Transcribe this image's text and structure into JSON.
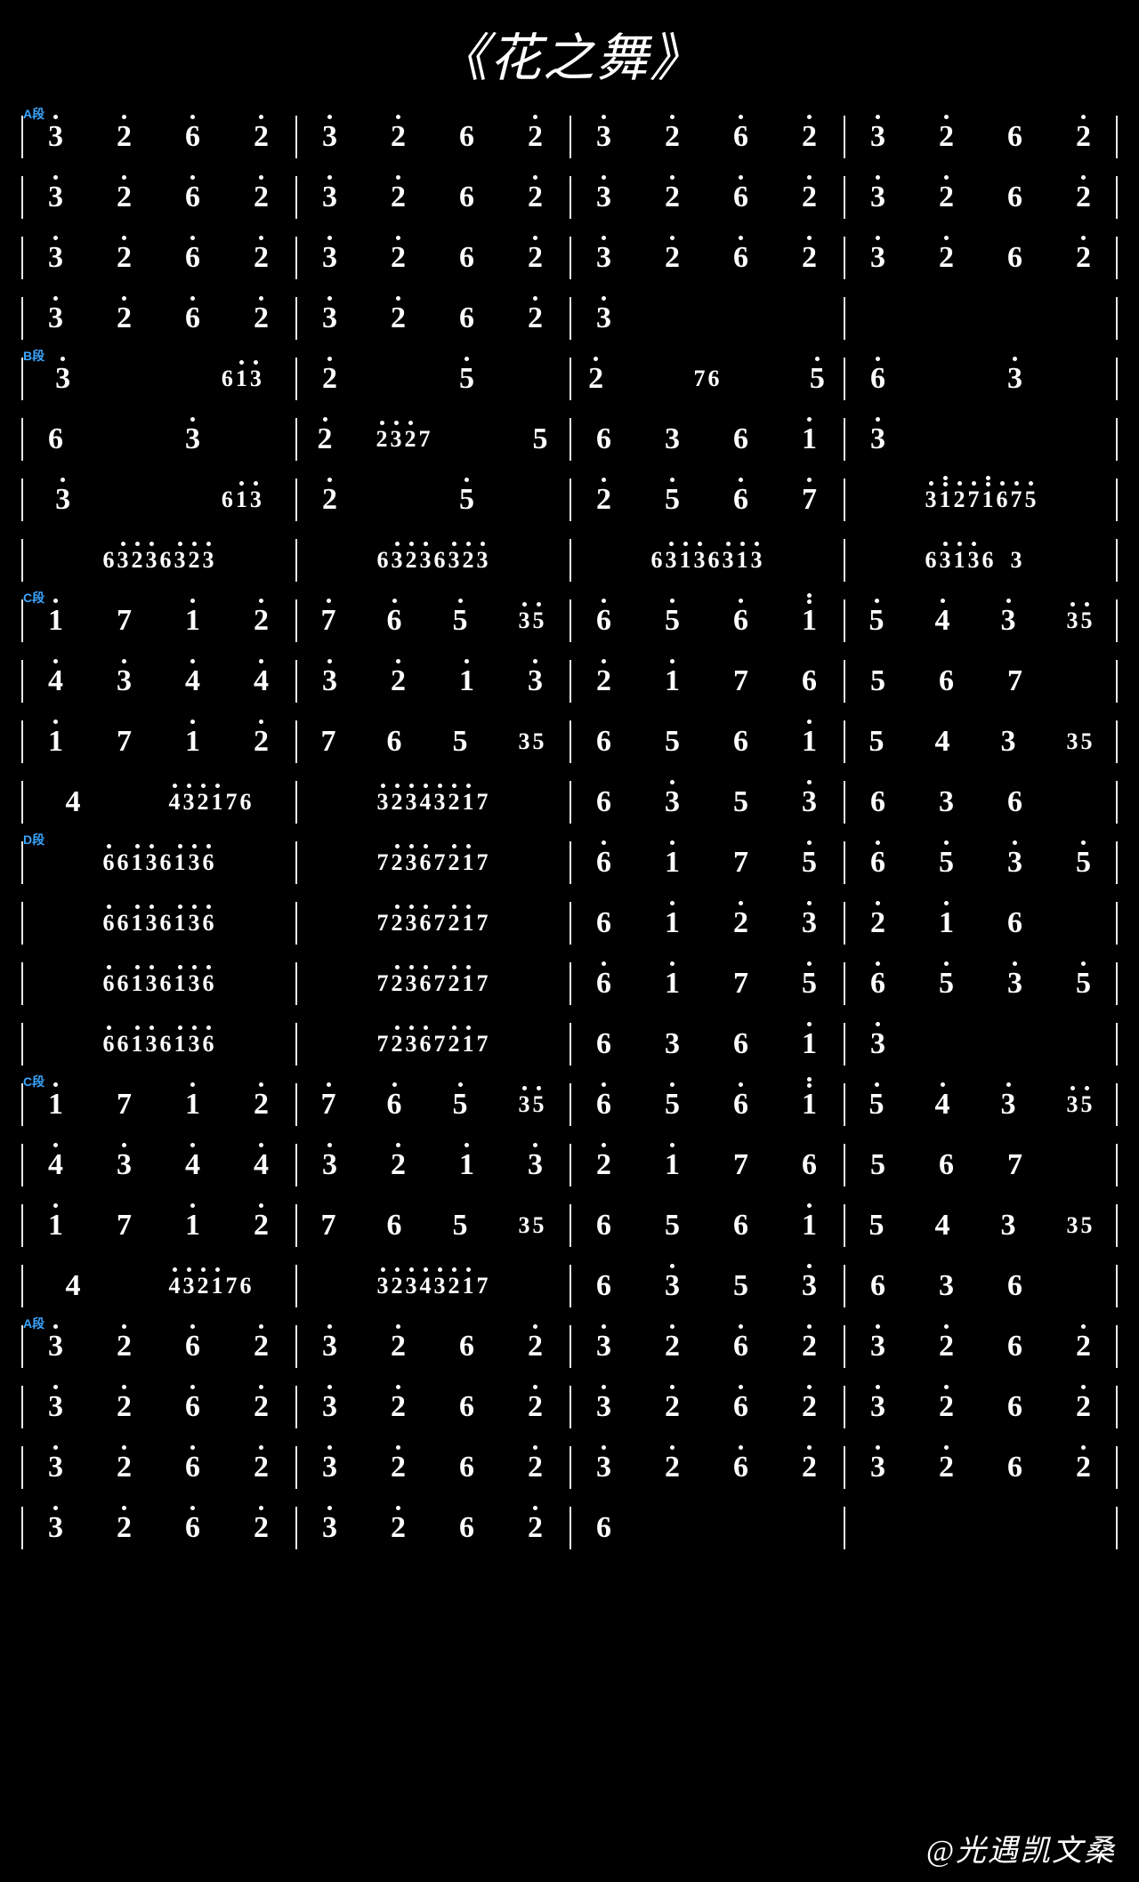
{
  "title": "《花之舞》",
  "credit": "@光遇凯文桑",
  "note_encoding": "Each note token: <digit><suffix>. digit 1-7 or _ (blank). suffix: '.'=dot above (high octave), ':'=two dots above, ','=dot below, ''=middle. Tokens separated by space inside a beat-group; groups separated by | inside a measure.",
  "lines": [
    {
      "section": "A段",
      "measures": [
        [
          "3.",
          "2.",
          "6.",
          "2."
        ],
        [
          "3.",
          "2.",
          "6",
          "2."
        ],
        [
          "3.",
          "2.",
          "6.",
          "2."
        ],
        [
          "3.",
          "2.",
          "6",
          "2."
        ]
      ]
    },
    {
      "measures": [
        [
          "3.",
          "2.",
          "6.",
          "2."
        ],
        [
          "3.",
          "2.",
          "6",
          "2."
        ],
        [
          "3.",
          "2.",
          "6.",
          "2."
        ],
        [
          "3.",
          "2.",
          "6",
          "2."
        ]
      ]
    },
    {
      "measures": [
        [
          "3.",
          "2.",
          "6.",
          "2."
        ],
        [
          "3.",
          "2.",
          "6",
          "2."
        ],
        [
          "3.",
          "2.",
          "6.",
          "2."
        ],
        [
          "3.",
          "2.",
          "6",
          "2."
        ]
      ]
    },
    {
      "measures": [
        [
          "3.",
          "2.",
          "6.",
          "2."
        ],
        [
          "3.",
          "2.",
          "6",
          "2."
        ],
        [
          "3.",
          "_",
          "_",
          "_"
        ],
        [
          "_",
          "_",
          "_",
          "_"
        ]
      ]
    },
    {
      "section": "B段",
      "measures": [
        [
          "3.",
          "_",
          "6 1. 3."
        ],
        [
          "2.",
          "_",
          "5.",
          "_"
        ],
        [
          "2.",
          "_",
          "7 6",
          "_",
          "5."
        ],
        [
          "6.",
          "_",
          "3.",
          "_"
        ]
      ]
    },
    {
      "measures": [
        [
          "6",
          "_",
          "3.",
          "_"
        ],
        [
          "2.",
          "2. 3. 2. 7",
          "_",
          "5"
        ],
        [
          "6",
          "3",
          "6",
          "1."
        ],
        [
          "3.",
          "_",
          "_",
          "_"
        ]
      ]
    },
    {
      "measures": [
        [
          "3.",
          "_",
          "6 1. 3."
        ],
        [
          "2.",
          "_",
          "5.",
          "_"
        ],
        [
          "2.",
          "5.",
          "6.",
          "7."
        ],
        [
          "3. 1: 2. 7. 1: 6. 7. 5."
        ]
      ]
    },
    {
      "measures": [
        [
          "6 3. 2. 3. 6 3. 2. 3."
        ],
        [
          "6 3. 2. 3. 6 3. 2. 3."
        ],
        [
          "6 3. 1. 3. 6 3. 1. 3."
        ],
        [
          "6 3. 1. 3. 6 _ 3 _"
        ]
      ]
    },
    {
      "section": "C段",
      "measures": [
        [
          "1.",
          "7",
          "1.",
          "2."
        ],
        [
          "7.",
          "6.",
          "5.",
          "3. 5."
        ],
        [
          "6.",
          "5.",
          "6.",
          "1:"
        ],
        [
          "5.",
          "4.",
          "3.",
          "3. 5."
        ]
      ]
    },
    {
      "measures": [
        [
          "4.",
          "3.",
          "4.",
          "4."
        ],
        [
          "3.",
          "2.",
          "1.",
          "3."
        ],
        [
          "2.",
          "1.",
          "7",
          "6"
        ],
        [
          "5",
          "6",
          "7",
          "_"
        ]
      ]
    },
    {
      "measures": [
        [
          "1.",
          "7",
          "1.",
          "2."
        ],
        [
          "7",
          "6",
          "5",
          "3 5"
        ],
        [
          "6",
          "5",
          "6",
          "1."
        ],
        [
          "5",
          "4",
          "3",
          "3 5"
        ]
      ]
    },
    {
      "measures": [
        [
          "4",
          "4. 3. 2. 1. 7 6"
        ],
        [
          "3. 2. 3. 4. 3. 2. 1. 7"
        ],
        [
          "6",
          "3.",
          "5",
          "3."
        ],
        [
          "6",
          "3",
          "6",
          "_"
        ]
      ]
    },
    {
      "section": "D段",
      "measures": [
        [
          "6. 6 1. 3. 6 1. 3. 6."
        ],
        [
          "7 2. 3. 6. 7 2. 1. 7"
        ],
        [
          "6.",
          "1.",
          "7",
          "5."
        ],
        [
          "6.",
          "5.",
          "3.",
          "5."
        ]
      ]
    },
    {
      "measures": [
        [
          "6. 6 1. 3. 6 1. 3. 6."
        ],
        [
          "7 2. 3. 6. 7 2. 1. 7"
        ],
        [
          "6",
          "1.",
          "2.",
          "3."
        ],
        [
          "2.",
          "1.",
          "6",
          "_"
        ]
      ]
    },
    {
      "measures": [
        [
          "6. 6 1. 3. 6 1. 3. 6."
        ],
        [
          "7 2. 3. 6. 7 2. 1. 7"
        ],
        [
          "6.",
          "1.",
          "7",
          "5."
        ],
        [
          "6.",
          "5.",
          "3.",
          "5."
        ]
      ]
    },
    {
      "measures": [
        [
          "6. 6 1. 3. 6 1. 3. 6."
        ],
        [
          "7 2. 3. 6. 7 2. 1. 7"
        ],
        [
          "6",
          "3",
          "6",
          "1."
        ],
        [
          "3.",
          "_",
          "_",
          "_"
        ]
      ]
    },
    {
      "section": "C段",
      "measures": [
        [
          "1.",
          "7",
          "1.",
          "2."
        ],
        [
          "7.",
          "6.",
          "5.",
          "3. 5."
        ],
        [
          "6.",
          "5.",
          "6.",
          "1:"
        ],
        [
          "5.",
          "4.",
          "3.",
          "3. 5."
        ]
      ]
    },
    {
      "measures": [
        [
          "4.",
          "3.",
          "4.",
          "4."
        ],
        [
          "3.",
          "2.",
          "1.",
          "3."
        ],
        [
          "2.",
          "1.",
          "7",
          "6"
        ],
        [
          "5",
          "6",
          "7",
          "_"
        ]
      ]
    },
    {
      "measures": [
        [
          "1.",
          "7",
          "1.",
          "2."
        ],
        [
          "7",
          "6",
          "5",
          "3 5"
        ],
        [
          "6",
          "5",
          "6",
          "1."
        ],
        [
          "5",
          "4",
          "3",
          "3 5"
        ]
      ]
    },
    {
      "measures": [
        [
          "4",
          "4. 3. 2. 1. 7 6"
        ],
        [
          "3. 2. 3. 4. 3. 2. 1. 7"
        ],
        [
          "6",
          "3.",
          "5",
          "3."
        ],
        [
          "6",
          "3",
          "6",
          "_"
        ]
      ]
    },
    {
      "section": "A段",
      "measures": [
        [
          "3.",
          "2.",
          "6.",
          "2."
        ],
        [
          "3.",
          "2.",
          "6",
          "2."
        ],
        [
          "3.",
          "2.",
          "6.",
          "2."
        ],
        [
          "3.",
          "2.",
          "6",
          "2."
        ]
      ]
    },
    {
      "measures": [
        [
          "3.",
          "2.",
          "6.",
          "2."
        ],
        [
          "3.",
          "2.",
          "6",
          "2."
        ],
        [
          "3.",
          "2.",
          "6.",
          "2."
        ],
        [
          "3.",
          "2.",
          "6",
          "2."
        ]
      ]
    },
    {
      "measures": [
        [
          "3.",
          "2.",
          "6.",
          "2."
        ],
        [
          "3.",
          "2.",
          "6",
          "2."
        ],
        [
          "3.",
          "2.",
          "6.",
          "2."
        ],
        [
          "3.",
          "2.",
          "6",
          "2."
        ]
      ]
    },
    {
      "measures": [
        [
          "3.",
          "2.",
          "6.",
          "2."
        ],
        [
          "3.",
          "2.",
          "6",
          "2."
        ],
        [
          "6",
          "_",
          "_",
          "_"
        ],
        [
          "_",
          "_",
          "_",
          "_"
        ]
      ]
    }
  ]
}
